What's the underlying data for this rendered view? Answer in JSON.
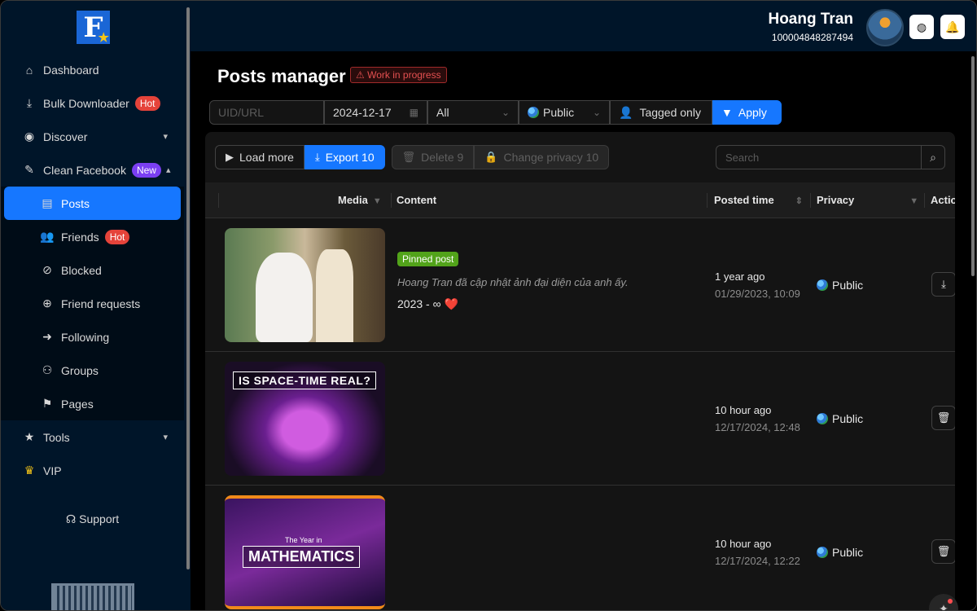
{
  "sidebar": {
    "logo_letter": "F",
    "items": [
      {
        "label": "Dashboard",
        "icon": "home-icon"
      },
      {
        "label": "Bulk Downloader",
        "icon": "download-icon",
        "badge": "Hot"
      },
      {
        "label": "Discover",
        "icon": "eye-icon"
      },
      {
        "label": "Clean Facebook",
        "icon": "broom-icon",
        "badge": "New"
      }
    ],
    "sub_items": [
      {
        "label": "Posts",
        "icon": "posts-icon"
      },
      {
        "label": "Friends",
        "icon": "friends-icon",
        "badge": "Hot"
      },
      {
        "label": "Blocked",
        "icon": "block-icon"
      },
      {
        "label": "Friend requests",
        "icon": "user-add-icon"
      },
      {
        "label": "Following",
        "icon": "following-icon"
      },
      {
        "label": "Groups",
        "icon": "groups-icon"
      },
      {
        "label": "Pages",
        "icon": "flag-icon"
      }
    ],
    "tools_label": "Tools",
    "vip_label": "VIP",
    "support_label": "Support"
  },
  "header": {
    "user_name": "Hoang Tran",
    "user_id": "100004848287494"
  },
  "main": {
    "title": "Posts manager",
    "wip_label": "Work in progress",
    "filters": {
      "uid_placeholder": "UID/URL",
      "date": "2024-12-17",
      "type": "All",
      "privacy": "Public",
      "tagged": "Tagged only",
      "apply": "Apply"
    },
    "toolbar": {
      "load_more": "Load more",
      "export": "Export 10",
      "delete": "Delete 9",
      "change_privacy": "Change privacy 10",
      "search_placeholder": "Search"
    },
    "columns": {
      "media": "Media",
      "content": "Content",
      "posted_time": "Posted time",
      "privacy": "Privacy",
      "action": "Actio"
    },
    "rows": [
      {
        "pinned": "Pinned post",
        "content_italic": "Hoang Tran đã cập nhật ảnh đại diện của anh ấy.",
        "content_text": "2023 - ∞",
        "heart": "❤️",
        "posted_rel": "1 year ago",
        "posted_abs": "01/29/2023, 10:09",
        "privacy": "Public",
        "action_icon": "download-icon"
      },
      {
        "thumb_title": "IS SPACE-TIME REAL?",
        "posted_rel": "10 hour ago",
        "posted_abs": "12/17/2024, 12:48",
        "privacy": "Public",
        "action_icon": "trash-icon"
      },
      {
        "thumb_small": "The Year in",
        "thumb_title": "MATHEMATICS",
        "posted_rel": "10 hour ago",
        "posted_abs": "12/17/2024, 12:22",
        "privacy": "Public",
        "action_icon": "trash-icon"
      }
    ]
  }
}
